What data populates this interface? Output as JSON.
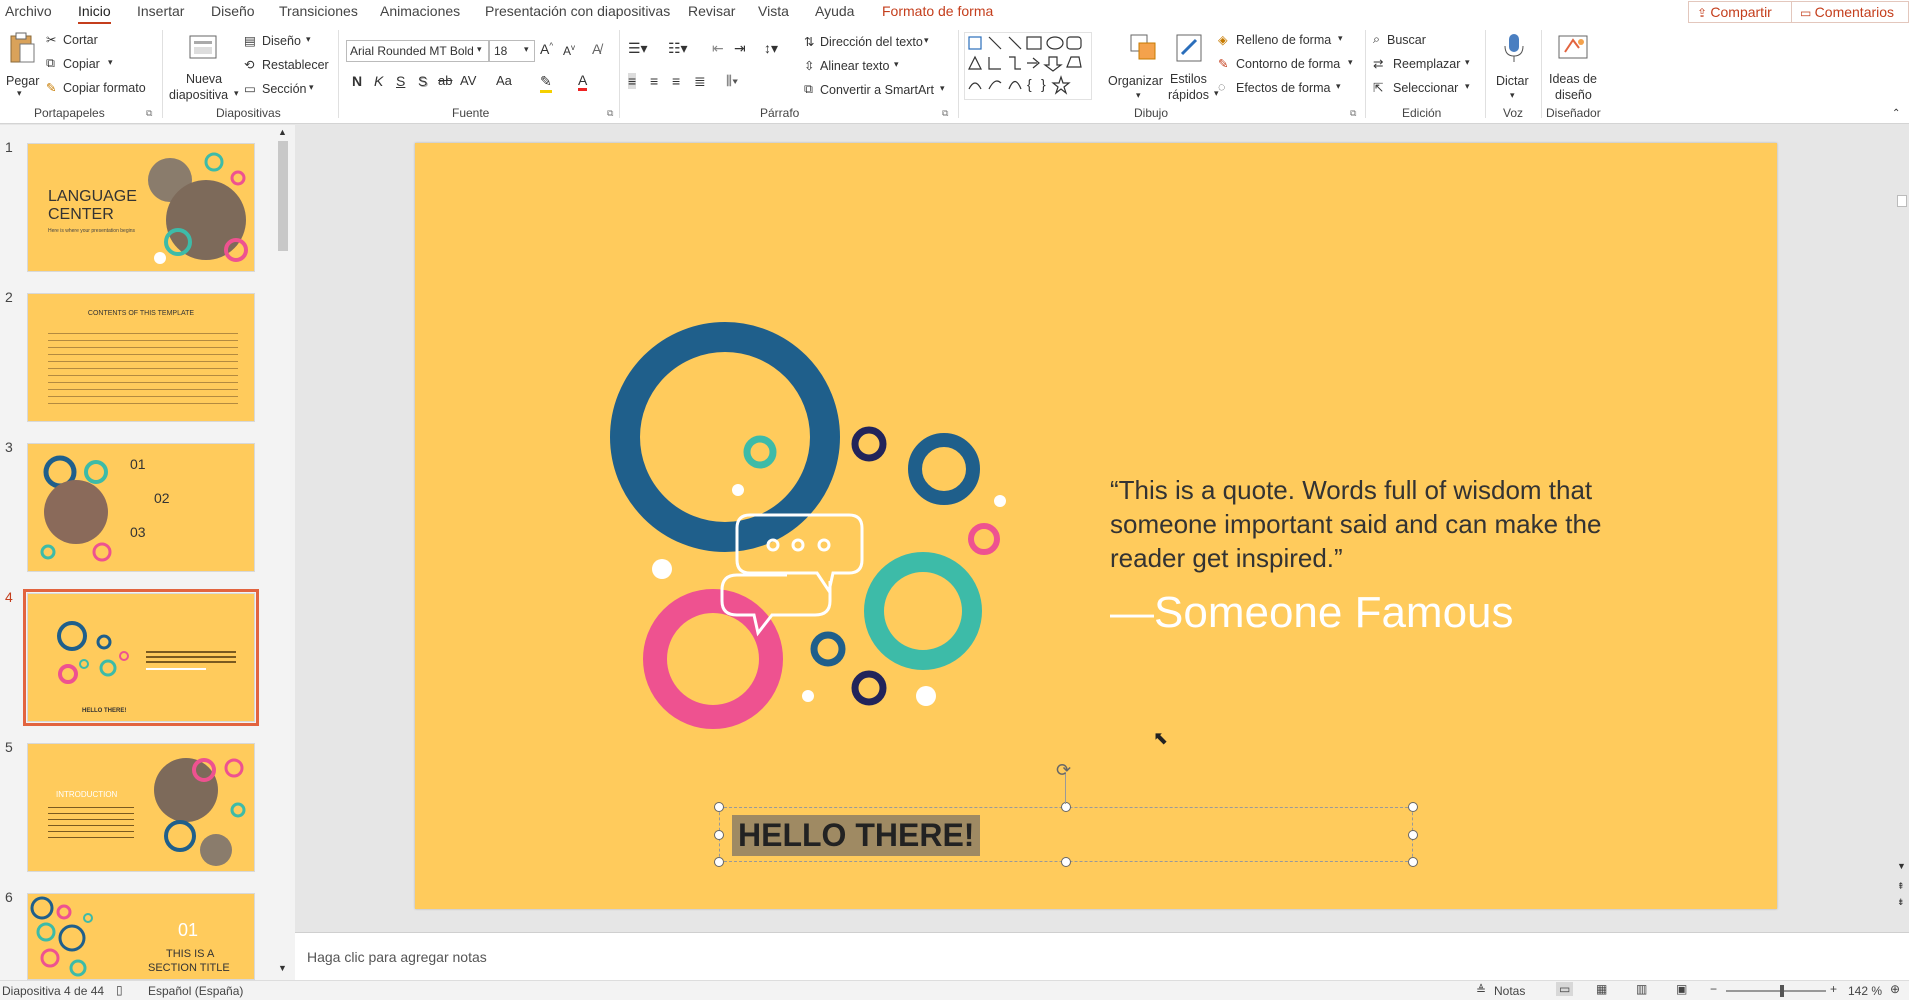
{
  "tabs": [
    {
      "label": "Archivo"
    },
    {
      "label": "Inicio"
    },
    {
      "label": "Insertar"
    },
    {
      "label": "Diseño"
    },
    {
      "label": "Transiciones"
    },
    {
      "label": "Animaciones"
    },
    {
      "label": "Presentación con diapositivas"
    },
    {
      "label": "Revisar"
    },
    {
      "label": "Vista"
    },
    {
      "label": "Ayuda"
    },
    {
      "label": "Formato de forma"
    }
  ],
  "share_label": "Compartir",
  "comments_label": "Comentarios",
  "ribbon": {
    "clipboard": {
      "paste": "Pegar",
      "cut": "Cortar",
      "copy": "Copiar",
      "format_painter": "Copiar formato",
      "group": "Portapapeles"
    },
    "slides": {
      "new_slide_1": "Nueva",
      "new_slide_2": "diapositiva",
      "layout": "Diseño",
      "reset": "Restablecer",
      "section": "Sección",
      "group": "Diapositivas"
    },
    "font": {
      "name": "Arial Rounded MT Bold",
      "size": "18",
      "bold": "N",
      "italic": "K",
      "underline": "S",
      "shadow": "S",
      "strike": "ab",
      "spacing": "AV",
      "case": "Aa",
      "group": "Fuente"
    },
    "paragraph": {
      "text_direction": "Dirección del texto",
      "align_text": "Alinear texto",
      "smartart": "Convertir a SmartArt",
      "group": "Párrafo"
    },
    "drawing": {
      "arrange": "Organizar",
      "quick_styles_1": "Estilos",
      "quick_styles_2": "rápidos",
      "fill": "Relleno de forma",
      "outline": "Contorno de forma",
      "effects": "Efectos de forma",
      "group": "Dibujo"
    },
    "editing": {
      "find": "Buscar",
      "replace": "Reemplazar",
      "select": "Seleccionar",
      "group": "Edición"
    },
    "voice": {
      "dictate": "Dictar",
      "group": "Voz"
    },
    "designer": {
      "ideas_1": "Ideas de",
      "ideas_2": "diseño",
      "group": "Diseñador"
    }
  },
  "thumbnails": [
    {
      "number": "1",
      "title_1": "LANGUAGE",
      "title_2": "CENTER",
      "subtitle": "Here is where your presentation begins"
    },
    {
      "number": "2",
      "title": "CONTENTS OF THIS TEMPLATE"
    },
    {
      "number": "3",
      "item1": "01",
      "item2": "02",
      "item3": "03"
    },
    {
      "number": "4",
      "label": "HELLO THERE!"
    },
    {
      "number": "5",
      "title": "INTRODUCTION"
    },
    {
      "number": "6",
      "number_big": "01",
      "title_1": "THIS IS A",
      "title_2": "SECTION TITLE"
    }
  ],
  "slide": {
    "quote": "“This is a quote. Words full of wisdom that someone important said and can make the reader get inspired.”",
    "author": "—Someone Famous",
    "textbox": "HELLO THERE!"
  },
  "notes_placeholder": "Haga clic para agregar notas",
  "status": {
    "slide_info": "Diapositiva 4 de 44",
    "language": "Español (España)",
    "notes": "Notas",
    "zoom": "142 %"
  },
  "colors": {
    "slide_bg": "#ffcb5c",
    "accent_red": "#c43e1c",
    "ring_blue": "#1f5f8b",
    "ring_teal": "#3dbba8",
    "ring_pink": "#ee5290",
    "ring_navy": "#22245a"
  }
}
